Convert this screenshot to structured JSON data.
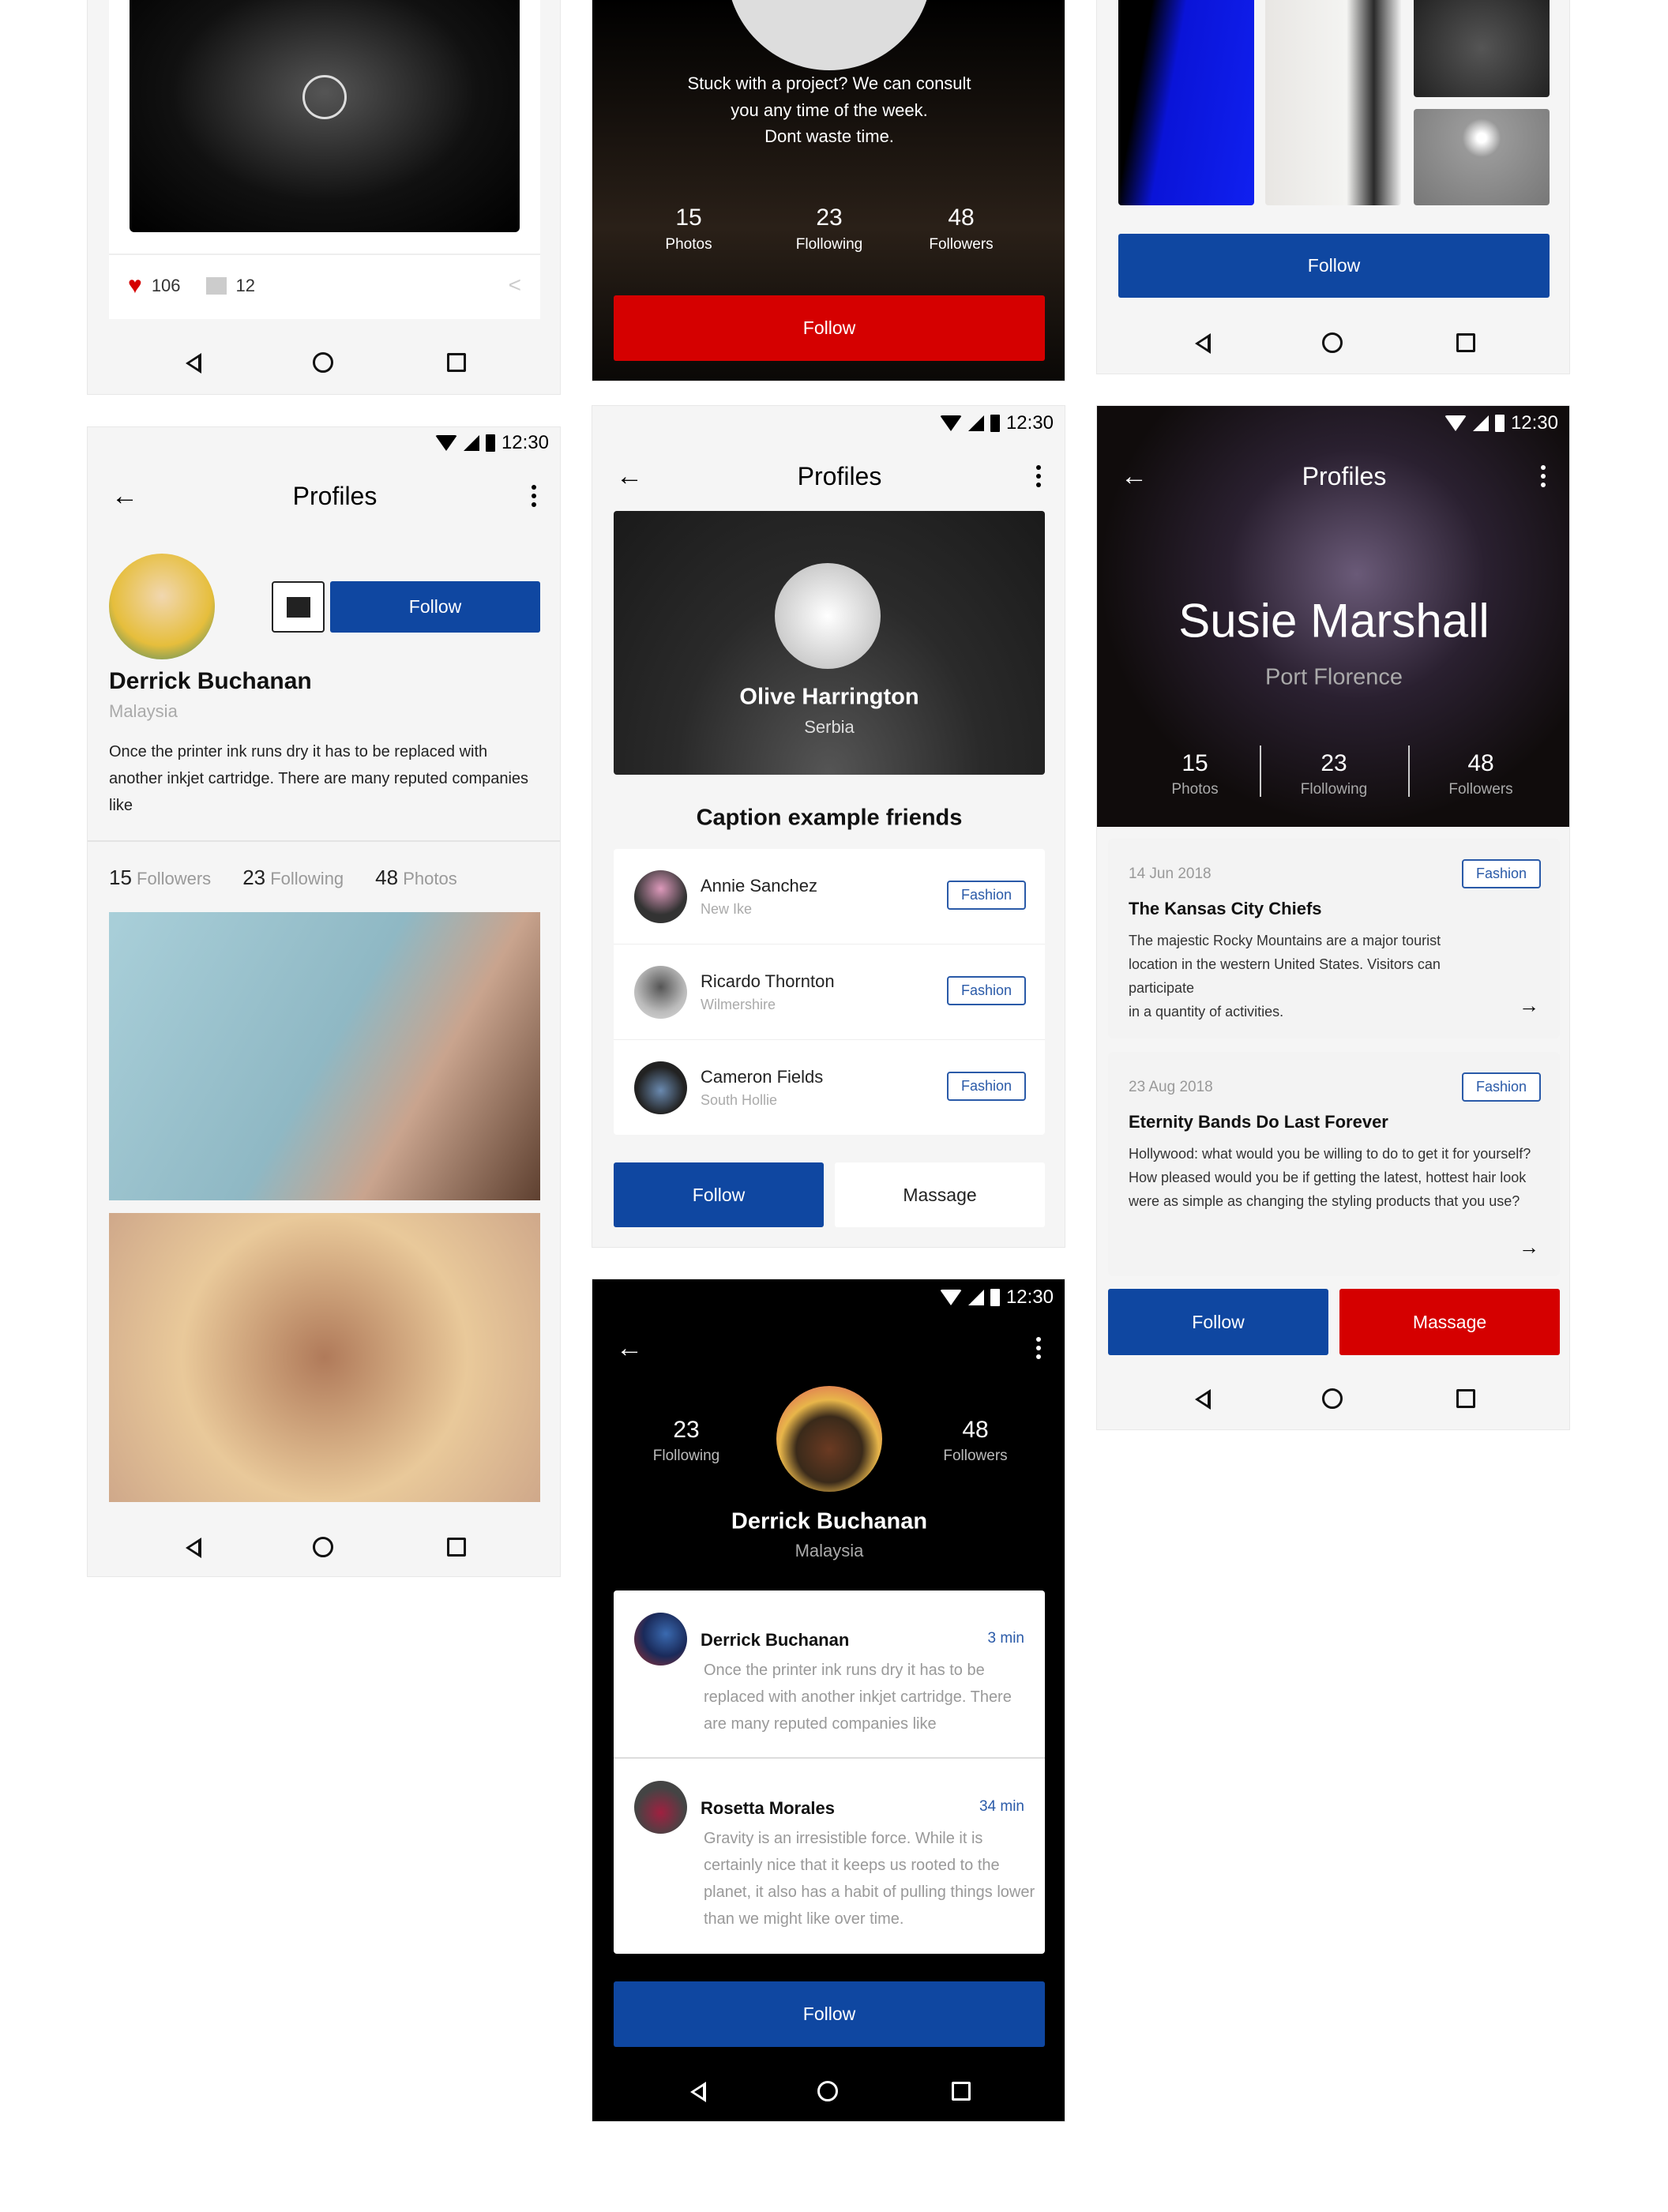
{
  "colors": {
    "primary": "#0f47a1",
    "accent": "#d50000",
    "background": "#f5f5f5"
  },
  "status": {
    "time": "12:30",
    "icons": [
      "wifi-icon",
      "signal-icon",
      "battery-icon"
    ]
  },
  "nav_icons": [
    "back-triangle-icon",
    "home-circle-icon",
    "recents-square-icon"
  ],
  "post_card": {
    "likes": "106",
    "comments": "12"
  },
  "consult": {
    "text_lines": [
      "Stuck with a project? We can consult",
      "you any time of the week.",
      "Dont waste time."
    ],
    "stats": [
      {
        "value": "15",
        "label": "Photos"
      },
      {
        "value": "23",
        "label": "Flollowing"
      },
      {
        "value": "48",
        "label": "Followers"
      }
    ],
    "follow": "Follow"
  },
  "gallery": {
    "follow": "Follow"
  },
  "profile_light": {
    "title": "Profiles",
    "follow": "Follow",
    "name": "Derrick Buchanan",
    "location": "Malaysia",
    "bio": "Once the printer ink runs dry it has to be replaced with another inkjet cartridge. There are many reputed companies like",
    "stats": [
      {
        "value": "15",
        "label": "Followers"
      },
      {
        "value": "23",
        "label": "Following"
      },
      {
        "value": "48",
        "label": "Photos"
      }
    ]
  },
  "friends": {
    "title": "Profiles",
    "name": "Olive Harrington",
    "location": "Serbia",
    "caption": "Caption example friends",
    "items": [
      {
        "name": "Annie Sanchez",
        "place": "New Ike",
        "tag": "Fashion"
      },
      {
        "name": "Ricardo Thornton",
        "place": "Wilmershire",
        "tag": "Fashion"
      },
      {
        "name": "Cameron Fields",
        "place": "South Hollie",
        "tag": "Fashion"
      }
    ],
    "follow": "Follow",
    "message": "Massage"
  },
  "comments": {
    "stats": [
      {
        "value": "23",
        "label": "Flollowing"
      },
      {
        "value": "48",
        "label": "Followers"
      }
    ],
    "name": "Derrick Buchanan",
    "location": "Malaysia",
    "items": [
      {
        "name": "Derrick Buchanan",
        "time": "3 min",
        "text": "Once the printer ink runs dry it has to be replaced with another inkjet cartridge. There are many reputed companies like"
      },
      {
        "name": "Rosetta Morales",
        "time": "34 min",
        "text": "Gravity is an irresistible force. While it is certainly nice that it keeps us rooted to the planet, it also has a habit of pulling things lower than we might like over time."
      }
    ],
    "follow": "Follow"
  },
  "hero": {
    "title": "Profiles",
    "name": "Susie Marshall",
    "location": "Port Florence",
    "stats": [
      {
        "value": "15",
        "label": "Photos"
      },
      {
        "value": "23",
        "label": "Flollowing"
      },
      {
        "value": "48",
        "label": "Followers"
      }
    ],
    "articles": [
      {
        "date": "14 Jun 2018",
        "tag": "Fashion",
        "title": "The Kansas City Chiefs",
        "text": "The majestic Rocky Mountains are a major tourist location in the western United States. Visitors can participate\nin a quantity of activities."
      },
      {
        "date": "23 Aug 2018",
        "tag": "Fashion",
        "title": "Eternity Bands Do Last Forever",
        "text": "Hollywood: what would you be willing to do to get it for yourself? How pleased would you be if getting the latest, hottest hair look were as simple as changing the styling products that you use?"
      }
    ],
    "follow": "Follow",
    "message": "Massage"
  }
}
